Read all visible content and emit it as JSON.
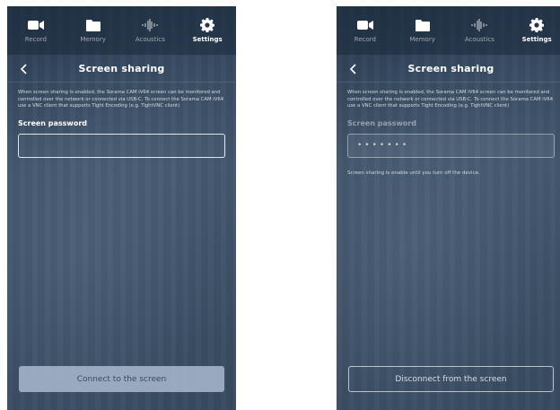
{
  "screens": [
    {
      "nav": [
        {
          "label": "Record",
          "icon": "video-camera-icon",
          "active": false
        },
        {
          "label": "Memory",
          "icon": "folder-icon",
          "active": false
        },
        {
          "label": "Acoustics",
          "icon": "waveform-icon",
          "active": false
        },
        {
          "label": "Settings",
          "icon": "gear-icon",
          "active": true
        }
      ],
      "title": "Screen sharing",
      "description": "When screen sharing is enabled, the Sorama CAM iV64 screen can be monitored and controlled over the network or connected via USB-C. To connect the Sorama CAM iV64 use a VNC client that supports Tight Encoding (e.g. TightVNC client)",
      "password_label": "Screen password",
      "password_value": "",
      "note": "",
      "button_label": "Connect to the screen"
    },
    {
      "nav": [
        {
          "label": "Record",
          "icon": "video-camera-icon",
          "active": false
        },
        {
          "label": "Memory",
          "icon": "folder-icon",
          "active": false
        },
        {
          "label": "Acoustics",
          "icon": "waveform-icon",
          "active": false
        },
        {
          "label": "Settings",
          "icon": "gear-icon",
          "active": true
        }
      ],
      "title": "Screen sharing",
      "description": "When screen sharing is enabled, the Sorama CAM iV64 screen can be monitored and controlled over the network or connected via USB-C. To connect the Sorama CAM iV64 use a VNC client that supports Tight Encoding (e.g. TightVNC client)",
      "password_label": "Screen password",
      "password_value": "•••••••",
      "note": "Screen sharing is enable until you turn off the device.",
      "button_label": "Disconnect from the screen"
    }
  ]
}
